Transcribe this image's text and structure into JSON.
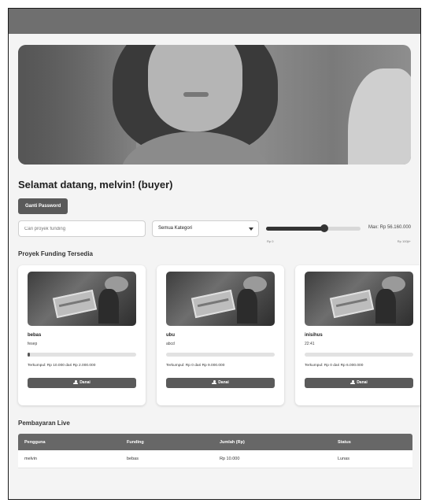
{
  "header": {},
  "welcome": {
    "text": "Selamat datang, melvin! (buyer)",
    "change_password_label": "Ganti Password"
  },
  "filters": {
    "search_placeholder": "Cari proyek funding",
    "category_selected": "Semua Kategori",
    "max_label": "Max: Rp 56.160.000",
    "slider_level": 0.62,
    "min_tick": "Rp 0",
    "max_tick": "Rp 100jt+"
  },
  "projects": {
    "title": "Proyek Funding Tersedia",
    "items": [
      {
        "name": "bebas",
        "description": "fesep",
        "raised_text": "Terkumpul: Rp 10.000 dari Rp 2.000.000",
        "progress": 0.005,
        "fund_label": "Danai"
      },
      {
        "name": "ubu",
        "description": "abcd",
        "raised_text": "Terkumpul: Rp 0 dari Rp 9.000.000",
        "progress": 0,
        "fund_label": "Danai"
      },
      {
        "name": "inisihus",
        "description": "22:41",
        "raised_text": "Terkumpul: Rp 0 dari Rp 6.000.000",
        "progress": 0,
        "fund_label": "Danai"
      }
    ]
  },
  "live": {
    "title": "Pembayaran Live",
    "columns": [
      "Pengguna",
      "Funding",
      "Jumlah (Rp)",
      "Status"
    ],
    "rows": [
      [
        "melvin",
        "bebas",
        "Rp 10.000",
        "Lunas"
      ]
    ]
  },
  "colors": {
    "topbar": "#6f6f6f",
    "button": "#5a5a5a",
    "table_header": "#676767"
  },
  "icons": {
    "fund_button": "user-icon",
    "category_select": "chevron-down-icon"
  }
}
